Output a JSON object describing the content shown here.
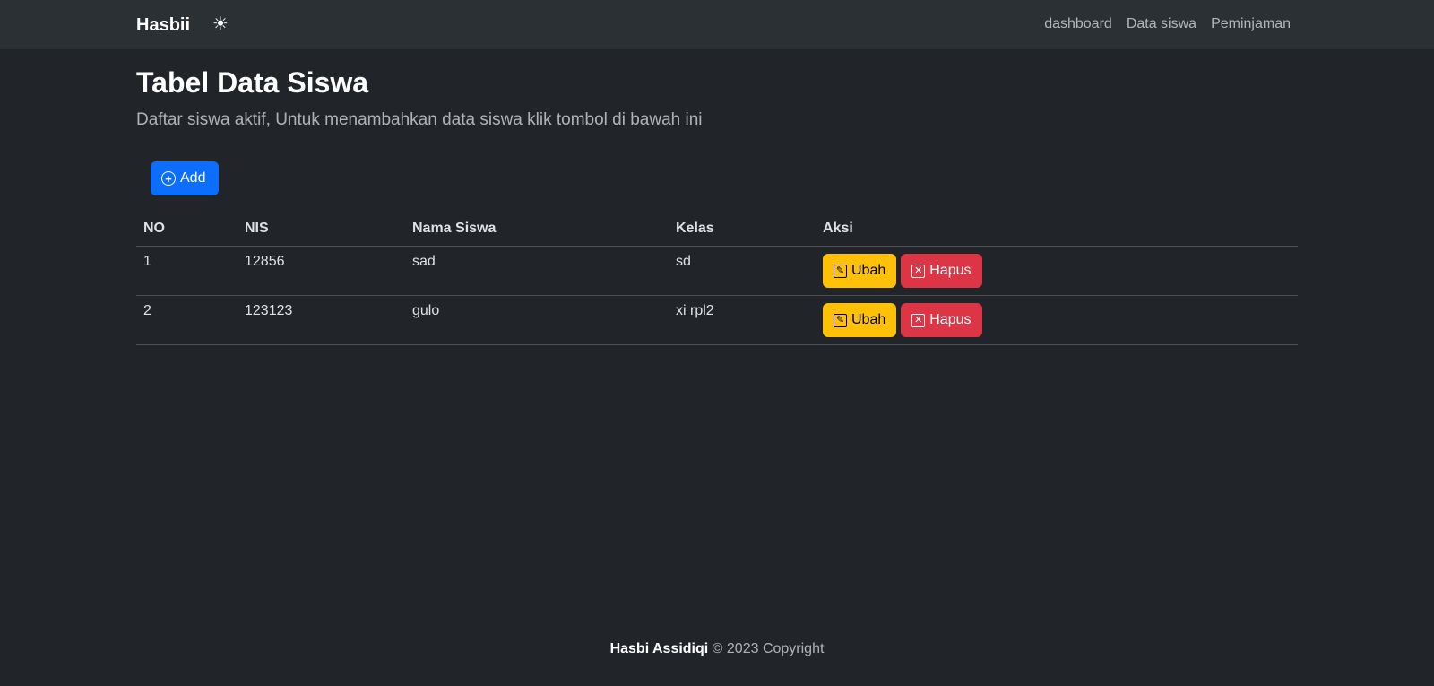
{
  "navbar": {
    "brand": "Hasbii",
    "theme_icon": "sun-icon",
    "theme_glyph": "☀",
    "links": [
      "dashboard",
      "Data siswa",
      "Peminjaman"
    ]
  },
  "header": {
    "title": "Tabel Data Siswa",
    "subtitle": "Daftar siswa aktif, Untuk menambahkan data siswa klik tombol di bawah ini"
  },
  "toolbar": {
    "add_label": "Add",
    "add_icon": "plus-circle-icon"
  },
  "table": {
    "columns": [
      "NO",
      "NIS",
      "Nama Siswa",
      "Kelas",
      "Aksi"
    ],
    "rows": [
      {
        "no": "1",
        "nis": "12856",
        "nama": "sad",
        "kelas": "sd"
      },
      {
        "no": "2",
        "nis": "123123",
        "nama": "gulo",
        "kelas": "xi rpl2"
      }
    ],
    "edit_label": "Ubah",
    "edit_icon": "pencil-square-icon",
    "delete_label": "Hapus",
    "delete_icon": "x-square-icon"
  },
  "footer": {
    "author": "Hasbi Assidiqi",
    "copyright": "© 2023 Copyright"
  },
  "colors": {
    "background": "#212529",
    "navbar": "#2b3035",
    "primary": "#0d6efd",
    "warning": "#ffc107",
    "danger": "#dc3545"
  }
}
